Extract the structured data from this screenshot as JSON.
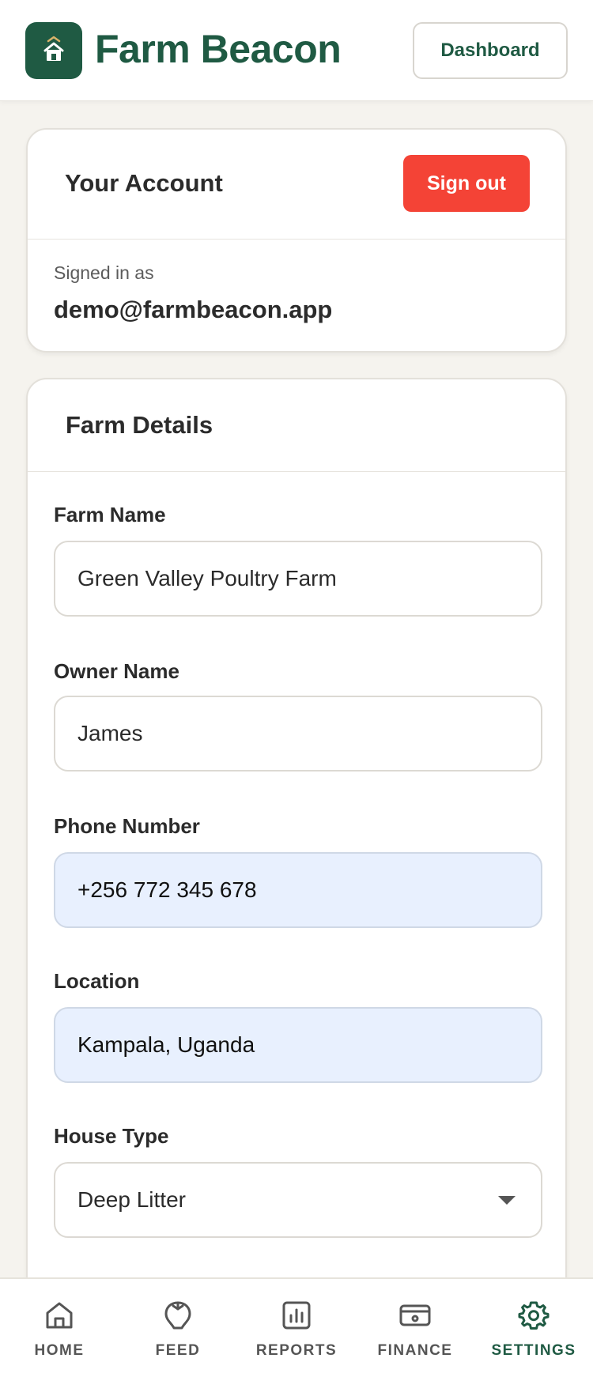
{
  "header": {
    "brand": "Farm Beacon",
    "dashboard_label": "Dashboard"
  },
  "account": {
    "title": "Your Account",
    "signout_label": "Sign out",
    "signed_in_label": "Signed in as",
    "email": "demo@farmbeacon.app"
  },
  "farm": {
    "title": "Farm Details",
    "fields": {
      "farm_name": {
        "label": "Farm Name",
        "value": "Green Valley Poultry Farm"
      },
      "owner_name": {
        "label": "Owner Name",
        "value": "James"
      },
      "phone": {
        "label": "Phone Number",
        "value": "+256 772 345 678"
      },
      "location": {
        "label": "Location",
        "value": "Kampala, Uganda"
      },
      "house_type": {
        "label": "House Type",
        "value": "Deep Litter"
      }
    }
  },
  "nav": {
    "items": [
      {
        "label": "HOME",
        "icon": "home-icon"
      },
      {
        "label": "FEED",
        "icon": "feed-icon"
      },
      {
        "label": "REPORTS",
        "icon": "reports-icon"
      },
      {
        "label": "FINANCE",
        "icon": "finance-icon"
      },
      {
        "label": "SETTINGS",
        "icon": "gear-icon"
      }
    ],
    "active": "SETTINGS"
  },
  "colors": {
    "brand": "#1f5a43",
    "danger": "#f44336",
    "background": "#f5f3ee",
    "autofill": "#e8f0fe"
  }
}
